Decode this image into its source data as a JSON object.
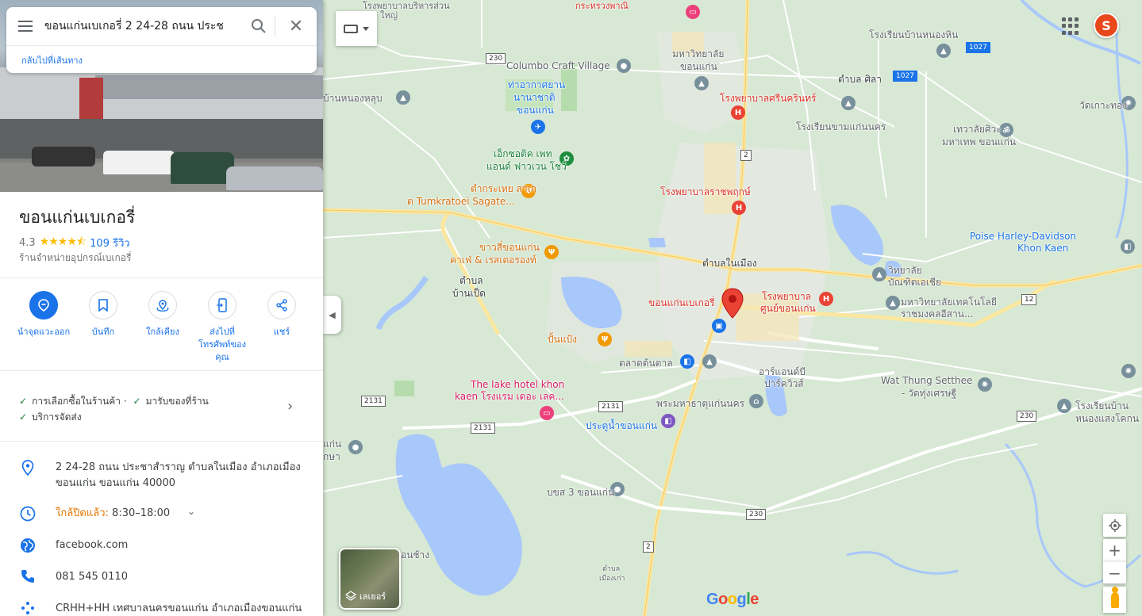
{
  "search": {
    "query": "ขอนแก่นเบเกอรี่ 2 24-28 ถนน ประช",
    "back_link": "กลับไปที่เส้นทาง"
  },
  "place": {
    "name": "ขอนแก่นเบเกอรี่",
    "rating": "4.3",
    "stars": "★★★★⯪",
    "reviews": "109 รีวิว",
    "category": "ร้านจำหน่ายอุปกรณ์เบเกอรี่"
  },
  "actions": [
    {
      "label": "นำจุดแวะออก",
      "icon": "remove-stop-icon"
    },
    {
      "label": "บันทึก",
      "icon": "bookmark-icon"
    },
    {
      "label": "ใกล้เคียง",
      "icon": "nearby-icon"
    },
    {
      "label": "ส่งไปที่โทรศัพท์ของคุณ",
      "icon": "send-to-phone-icon"
    },
    {
      "label": "แชร์",
      "icon": "share-icon"
    }
  ],
  "amenities": {
    "item1": "การเลือกซื้อในร้านค้า",
    "sep": "·",
    "item2": "มารับของที่ร้าน",
    "item3": "บริการจัดส่ง"
  },
  "info": {
    "address": "2 24-28 ถนน ประชาสำราญ ตำบลในเมือง อำเภอเมืองขอนแก่น ขอนแก่น 40000",
    "hours_status": "ใกล้ปิดแล้ว:",
    "hours_time": "8:30–18:00",
    "website": "facebook.com",
    "phone": "081 545 0110",
    "plus_code": "CRHH+HH เทศบาลนครขอนแก่น อำเภอเมืองขอนแก่น"
  },
  "map": {
    "marker_label": "ขอนแก่นเบเกอรี่",
    "layers_label": "เลเยอร์",
    "google": [
      "G",
      "o",
      "o",
      "g",
      "l",
      "e"
    ],
    "avatar_letter": "S",
    "labels": {
      "columbo": "Columbo Craft Village",
      "airport1": "ท่าอากาศยาน",
      "airport2": "นานาชาติ",
      "airport3": "ขอนแก่น",
      "exotic1": "เอ็กซอติค เพท",
      "exotic2": "แอนด์ ฟาวเวน โชว์",
      "tumk1": "ตำกระเทย สาเก",
      "tumk2": "ต Tumkratoei Sagate...",
      "khaos1": "ขาวสี่ขอนแก่น",
      "khaos2": "คาเฟ่ & เรสเตอรองท์",
      "tambon_baanped1": "ตำบล",
      "tambon_baanped2": "บ้านเป็ด",
      "ponpang": "ปั้นแป้ง",
      "lakehotel1": "The lake hotel khon",
      "lakehotel2": "kaen โรงแรม เดอะ เลค...",
      "talad": "ตลาดต้นตาล",
      "pramaha": "พระมหาธาตุแก่นนคร",
      "pratunam": "ประตูน้ำขอนแก่น",
      "art1": "อาร์แอนด์บี",
      "art2": "ปาร์ควิวส์",
      "uni1": "มหาวิทยาลัย",
      "uni2": "ขอนแก่น",
      "srinagarind": "โรงพยาบาลศรีนครินทร์",
      "ratchaphruek": "โรงพยาบาลราชพฤกษ์",
      "tambon_nai": "ตำบลในเมือง",
      "hospital_center1": "โรงพยาบาล",
      "hospital_center2": "ศูนย์ขอนแก่น",
      "tambon_sila": "ตำบล ศิลา",
      "school_khamkhaen": "โรงเรียนขามแก่นนคร",
      "school_nonghin": "โรงเรียนบ้านหนองหิน",
      "dev1": "เทวาลัยศิวะ",
      "dev2": "มหาเทพ ขอนแก่น",
      "watko": "วัดเกาะทอง",
      "poise1": "Poise Harley-Davidson",
      "poise2": "Khon Kaen",
      "vit1": "วิทยาลัย",
      "vit2": "บัณฑิตเอเชีย",
      "rmu1": "มหาวิทยาลัยเทคโนโลยี",
      "rmu2": "ราชมงคลอีสาน...",
      "wat_thung1": "Wat Thung Setthee",
      "wat_thung2": "- วัดทุ่งเศรษฐี",
      "school_right1": "โรงเรียนบ้าน",
      "school_right2": "หนองแสงโคกน",
      "bs3": "บขส 3 ขอนแก่น",
      "nonghluep": "บ้านหนองหลุบ",
      "khok1": "แก่น",
      "khok2": "กษา",
      "nongchang": "อนช้าง",
      "tambon_mueang1": "ตำบล",
      "tambon_mueang2": "เมืองเก่า",
      "topchurch": "โรงพยาบาลบริหารส่วน",
      "top_mid": "ใหญ่",
      "top_red": "กระทรวงพาณิ"
    },
    "shields": {
      "r230a": "230",
      "r2a": "2",
      "r2b": "2",
      "r1027a": "1027",
      "r1027b": "1027",
      "r12": "12",
      "r2131a": "2131",
      "r2131b": "2131",
      "r2131c": "2131",
      "r230b": "230",
      "r230c": "230"
    }
  }
}
